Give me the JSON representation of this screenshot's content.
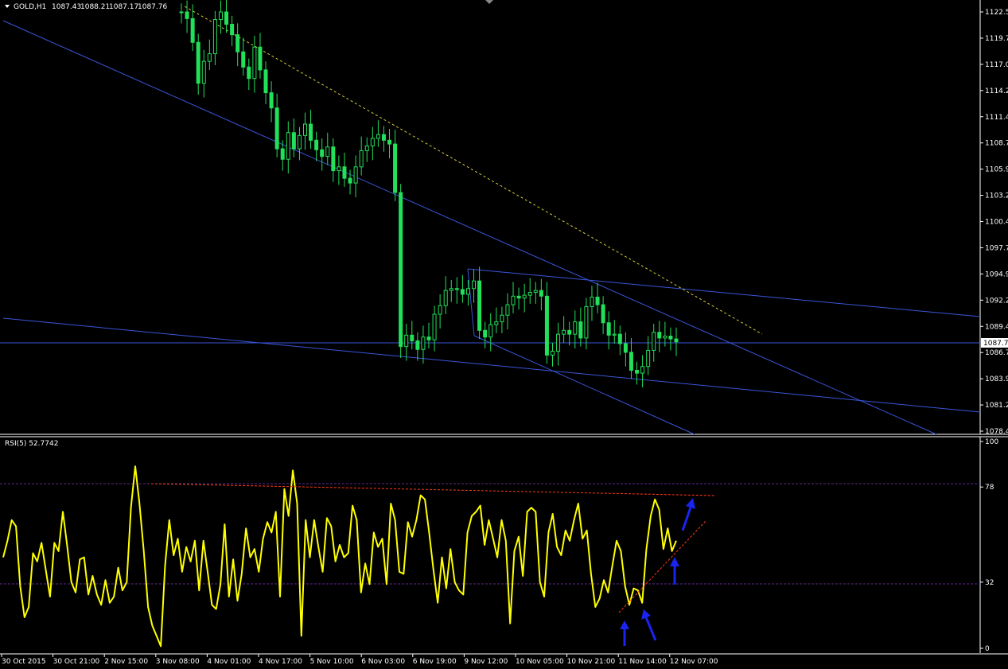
{
  "header": {
    "symbol_label": "GOLD,H1",
    "ohlc": [
      "1087.43",
      "1088.21",
      "1087.17",
      "1087.76"
    ],
    "rsi_label": "RSI(5) 52.7742"
  },
  "colors": {
    "background": "#000000",
    "candle": "#22e05a",
    "trendline": "#3a55d8",
    "dotted_line": "#d9cf3a",
    "rsi_line": "#ffff00",
    "rsi_level": "#5b2a8c",
    "rsi_trend": "#ff3a18",
    "arrow": "#1a24f0",
    "axis": "#ffffff"
  },
  "price_axis": {
    "ticks": [
      "1122.5",
      "1119.7",
      "1117.0",
      "1114.2",
      "1111.4",
      "1108.7",
      "1105.9",
      "1103.2",
      "1100.4",
      "1097.7",
      "1094.9",
      "1092.2",
      "1089.4",
      "1086.7",
      "1083.9",
      "1081.2",
      "1078.4"
    ],
    "current_price": "1087.7"
  },
  "rsi_axis": {
    "ticks": [
      "100",
      "78",
      "32",
      "0"
    ]
  },
  "time_axis": {
    "labels": [
      "30 Oct 2015",
      "30 Oct 21:00",
      "2 Nov 15:00",
      "3 Nov 08:00",
      "4 Nov 01:00",
      "4 Nov 17:00",
      "5 Nov 10:00",
      "6 Nov 03:00",
      "6 Nov 19:00",
      "9 Nov 12:00",
      "10 Nov 05:00",
      "10 Nov 21:00",
      "11 Nov 14:00",
      "12 Nov 07:00"
    ]
  },
  "chart_data": [
    {
      "type": "candlestick",
      "panel": "price",
      "title": "GOLD,H1",
      "ylim": [
        1078.4,
        1122.5
      ],
      "series": [
        {
          "name": "GOLD,H1",
          "close": [
            1122.5,
            1121.8,
            1119.3,
            1115.0,
            1117.3,
            1118.1,
            1121.7,
            1122.5,
            1121.2,
            1120.1,
            1118.3,
            1116.7,
            1115.5,
            1118.8,
            1116.4,
            1114.0,
            1112.4,
            1108.1,
            1107.0,
            1109.8,
            1108.1,
            1109.5,
            1110.7,
            1109.0,
            1108.0,
            1107.3,
            1108.3,
            1105.8,
            1106.2,
            1105.0,
            1104.5,
            1106.2,
            1107.9,
            1108.4,
            1109.2,
            1109.6,
            1109.0,
            1108.6,
            1103.5,
            1087.3,
            1088.5,
            1087.9,
            1087.0,
            1088.3,
            1088.0,
            1090.7,
            1091.6,
            1093.2,
            1093.4,
            1093.3,
            1092.8,
            1093.4,
            1094.2,
            1089.0,
            1088.3,
            1089.6,
            1089.9,
            1090.6,
            1091.7,
            1092.6,
            1092.4,
            1092.7,
            1093.0,
            1093.2,
            1092.6,
            1086.4,
            1086.8,
            1088.6,
            1089.0,
            1088.6,
            1089.9,
            1088.2,
            1091.5,
            1092.5,
            1091.7,
            1089.8,
            1088.5,
            1088.6,
            1087.6,
            1086.7,
            1084.8,
            1084.5,
            1085.2,
            1086.9,
            1088.8,
            1088.2,
            1088.4,
            1088.1,
            1087.8
          ]
        }
      ],
      "trendlines": [
        "blue upper channel",
        "blue lower channel",
        "blue wedge top",
        "blue wedge bottom",
        "dotted resistance"
      ],
      "horizontal_line": 1087.7
    },
    {
      "type": "line",
      "panel": "indicator",
      "title": "RSI(5) 52.7742",
      "ylim": [
        0,
        100
      ],
      "levels": [
        78,
        32
      ],
      "series": [
        {
          "name": "RSI(5)",
          "values": [
            44,
            52,
            62,
            59,
            30,
            15,
            20,
            46,
            42,
            51,
            38,
            25,
            51,
            47,
            66,
            50,
            32,
            27,
            43,
            44,
            26,
            35,
            26,
            21,
            33,
            22,
            25,
            39,
            28,
            32,
            68,
            88,
            70,
            47,
            20,
            11,
            6,
            1,
            40,
            62,
            45,
            53,
            37,
            49,
            42,
            52,
            28,
            52,
            37,
            21,
            19,
            31,
            60,
            25,
            43,
            23,
            36,
            58,
            44,
            48,
            37,
            53,
            61,
            56,
            66,
            25,
            77,
            64,
            86,
            70,
            6,
            62,
            44,
            62,
            49,
            37,
            63,
            59,
            42,
            50,
            44,
            46,
            69,
            62,
            27,
            41,
            31,
            56,
            49,
            53,
            31,
            70,
            62,
            37,
            36,
            61,
            54,
            62,
            74,
            72,
            56,
            38,
            22,
            44,
            29,
            48,
            32,
            28,
            26,
            56,
            64,
            66,
            69,
            50,
            62,
            53,
            44,
            62,
            52,
            12,
            47,
            54,
            35,
            66,
            68,
            66,
            32,
            25,
            56,
            65,
            49,
            45,
            57,
            52,
            62,
            70,
            53,
            57,
            36,
            20,
            24,
            33,
            27,
            40,
            52,
            47,
            30,
            21,
            29,
            28,
            22,
            48,
            64,
            72,
            67,
            48,
            58,
            47,
            52
          ]
        }
      ],
      "trendlines": [
        "red horizontal resistance",
        "red rising support"
      ],
      "arrows": [
        "up-left",
        "up-left",
        "up",
        "up"
      ]
    }
  ]
}
